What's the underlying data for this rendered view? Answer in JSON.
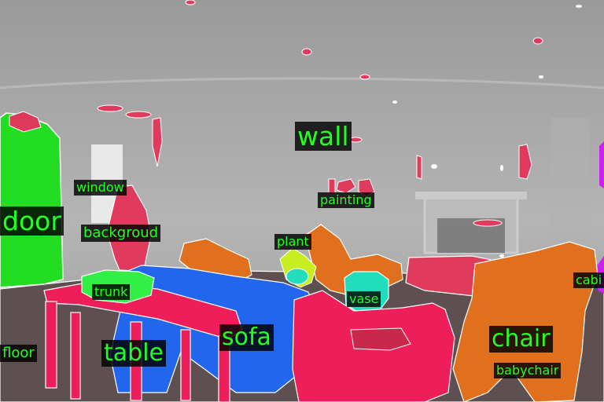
{
  "scene": {
    "labels": {
      "wall": "wall",
      "window": "window",
      "door": "door",
      "backgroud": "backgroud",
      "painting": "painting",
      "plant": "plant",
      "trunk": "trunk",
      "vase": "vase",
      "cabi": "cabi",
      "floor": "floor",
      "table": "table",
      "sofa": "sofa",
      "chair": "chair",
      "babychair": "babychair"
    },
    "colors": {
      "wall": "#a9a9a9",
      "door": "#22dd22",
      "floor": "#5e5050",
      "table": "#ee1e5a",
      "sofa": "#2266ee",
      "chair": "#e0701e",
      "trunk": "#33ee44",
      "vase": "#22ddbb",
      "plant": "#c8ee22",
      "cabinet": "#cc22ee",
      "label_text": "#22ff22",
      "label_bg": "#000000"
    }
  }
}
